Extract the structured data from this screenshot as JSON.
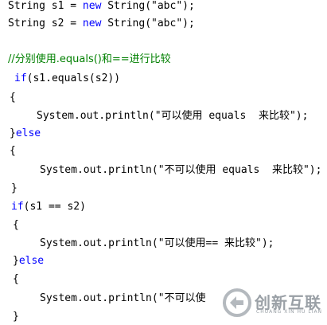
{
  "code": {
    "l1": {
      "t1": "String s1 = ",
      "kw": "new",
      "t2": " String(\"abc\");"
    },
    "l2": {
      "t1": "String s2 = ",
      "kw": "new",
      "t2": " String(\"abc\");"
    },
    "l3": {
      "comment": "//分别使用.equals()和==进行比较"
    },
    "l4": {
      "kw": "if",
      "t2": "(s1.equals(s2))"
    },
    "l5": {
      "t": "{"
    },
    "l6": {
      "t": "System.out.println(\"可以使用 equals  来比较\");"
    },
    "l7": {
      "t": "}",
      "kw": "else"
    },
    "l8": {
      "t": "{"
    },
    "l9": {
      "t": "System.out.println(\"不可以使用 equals  来比较\");"
    },
    "l10": {
      "t": "}"
    },
    "l11": {
      "kw": "if",
      "t2": "(s1 == s2)"
    },
    "l12": {
      "t": "{"
    },
    "l13": {
      "t": "System.out.println(\"可以使用== 来比较\");"
    },
    "l14": {
      "t": "}",
      "kw": "else"
    },
    "l15": {
      "t": "{"
    },
    "l16": {
      "t": "System.out.println(\"不可以使"
    },
    "l17": {
      "t": "}"
    }
  },
  "watermark": {
    "text": "创新互联",
    "sub": "CHUANG XIN HU LIAN"
  },
  "colors": {
    "keyword": "#0000ff",
    "comment": "#008000",
    "text": "#000000",
    "watermark": "#9aa0a6"
  }
}
